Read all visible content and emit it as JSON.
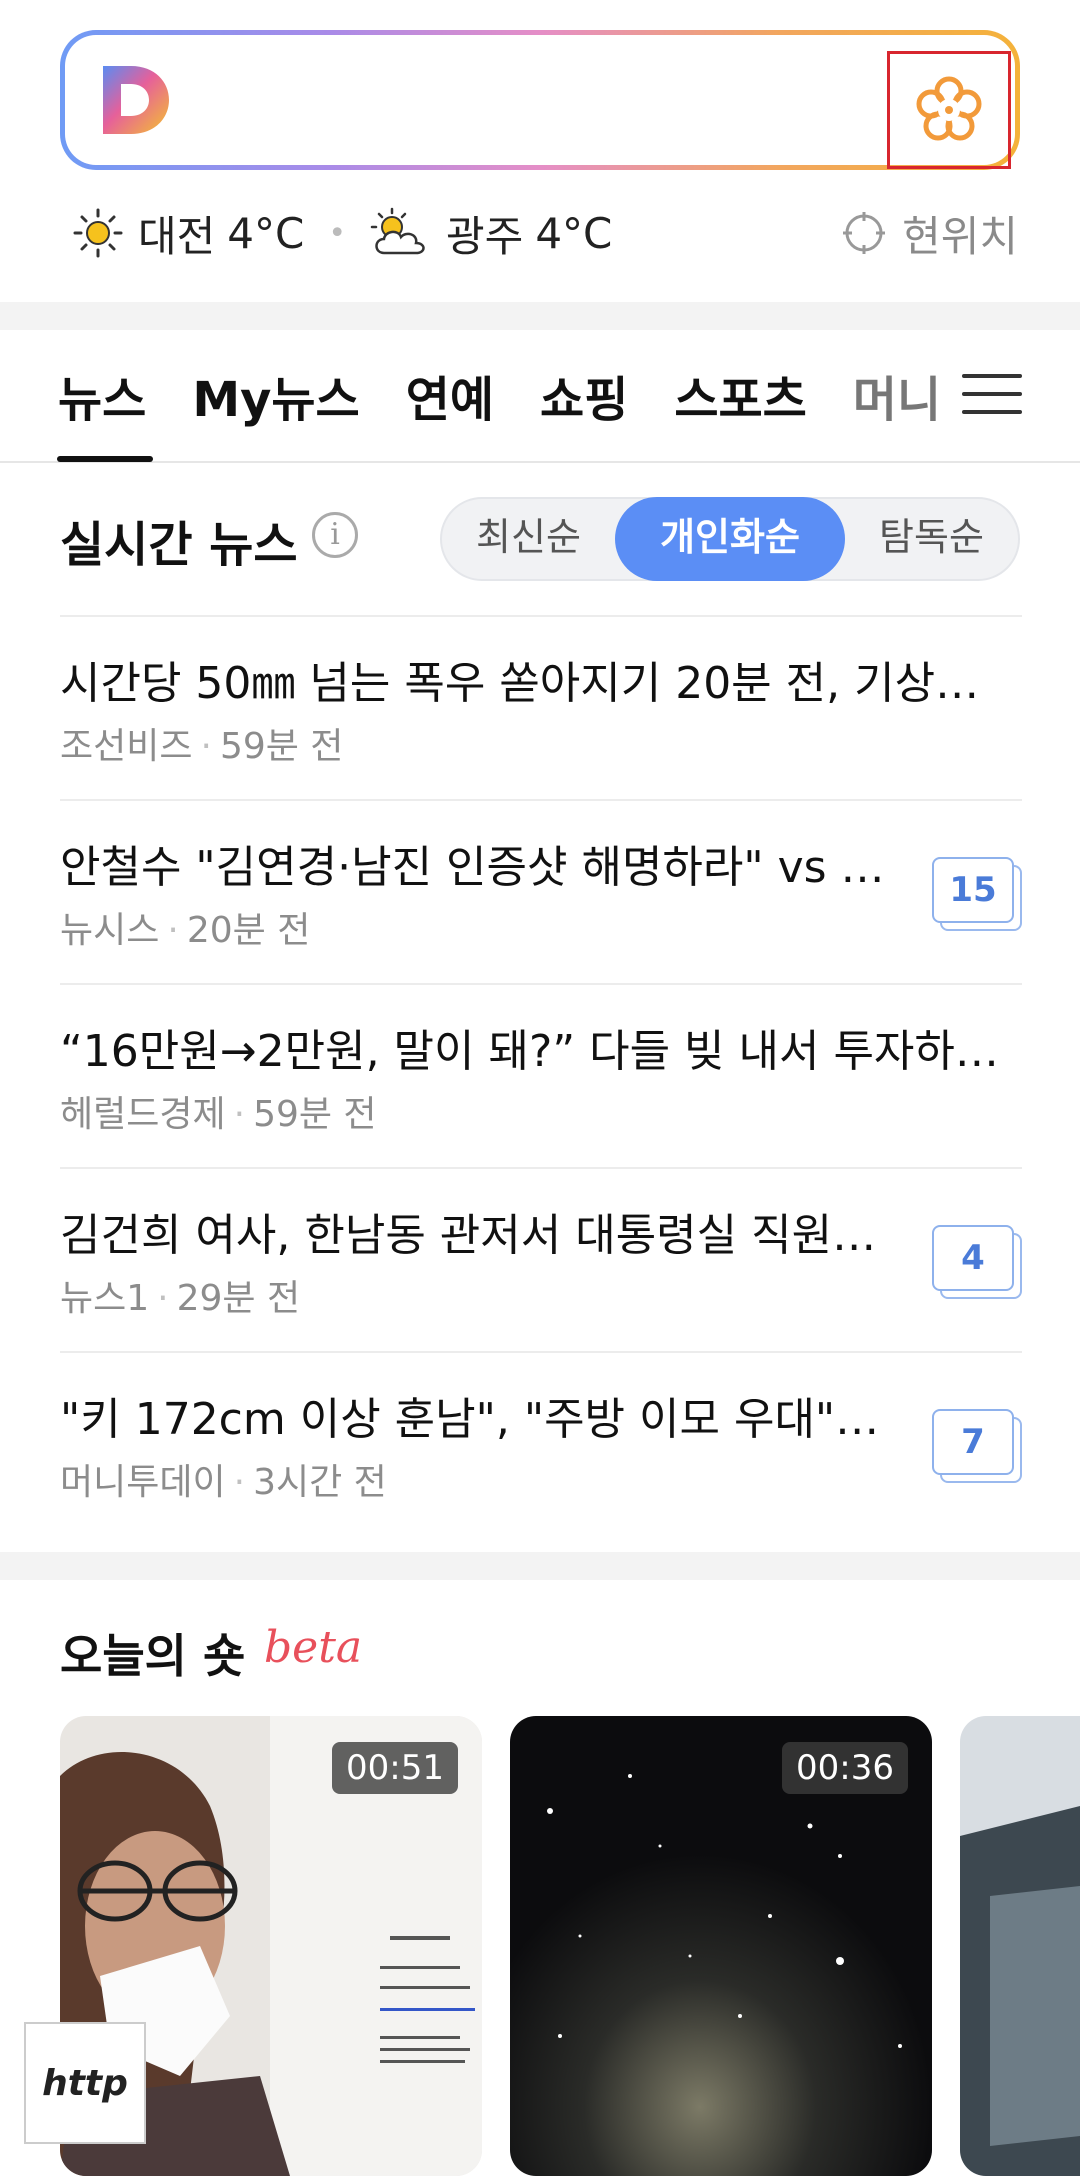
{
  "search": {
    "logo_letter": "D",
    "flower_icon": "flower-icon"
  },
  "weather": [
    {
      "icon": "sun-icon",
      "city": "대전",
      "temp": "4°C"
    },
    {
      "icon": "partly-cloudy-icon",
      "city": "광주",
      "temp": "4°C"
    }
  ],
  "location_label": "현위치",
  "tabs": [
    "뉴스",
    "My뉴스",
    "연예",
    "쇼핑",
    "스포츠",
    "머니"
  ],
  "active_tab": "뉴스",
  "realtime": {
    "title": "실시간 뉴스",
    "info_glyph": "i",
    "sort_options": [
      "최신순",
      "개인화순",
      "탐독순"
    ],
    "active_sort": "개인화순"
  },
  "news": [
    {
      "title": "시간당 50㎜ 넘는 폭우 쏟아지기 20분 전, 기상…",
      "source": "조선비즈",
      "time": "59분 전",
      "count": ""
    },
    {
      "title": "안철수 \"김연경·남진 인증샷 해명하라\" vs …",
      "source": "뉴시스",
      "time": "20분 전",
      "count": "15"
    },
    {
      "title": "“16만원→2만원, 말이 돼?” 다들 빚 내서 투자하…",
      "source": "헤럴드경제",
      "time": "59분 전",
      "count": ""
    },
    {
      "title": "김건희 여사, 한남동 관저서 대통령실 직원 …",
      "source": "뉴스1",
      "time": "29분 전",
      "count": "4"
    },
    {
      "title": "\"키 172cm 이상 훈남\", \"주방 이모 우대\"……",
      "source": "머니투데이",
      "time": "3시간 전",
      "count": "7"
    }
  ],
  "shots": {
    "title": "오늘의 숏",
    "badge": "beta",
    "items": [
      {
        "duration": "00:51"
      },
      {
        "duration": "00:36"
      }
    ]
  },
  "overlay_label": "http"
}
